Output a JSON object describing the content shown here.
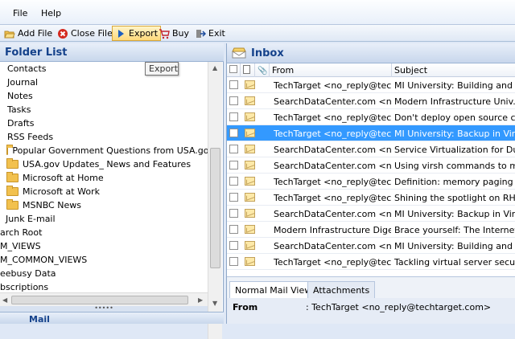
{
  "menu": {
    "file": "File",
    "help": "Help"
  },
  "toolbar": {
    "add_file": "Add File",
    "close_file": "Close File",
    "export": "Export",
    "buy": "Buy",
    "exit": "Exit"
  },
  "tooltip": "Export",
  "folder_list": {
    "title": "Folder List",
    "items": [
      {
        "label": "Contacts",
        "folder": false
      },
      {
        "label": "Journal",
        "folder": false
      },
      {
        "label": "Notes",
        "folder": false
      },
      {
        "label": "Tasks",
        "folder": false
      },
      {
        "label": "Drafts",
        "folder": false
      },
      {
        "label": "RSS Feeds",
        "folder": false
      },
      {
        "label": "Popular Government Questions from USA.gov",
        "folder": true
      },
      {
        "label": "USA.gov Updates_ News and Features",
        "folder": true
      },
      {
        "label": "Microsoft at Home",
        "folder": true
      },
      {
        "label": "Microsoft at Work",
        "folder": true
      },
      {
        "label": "MSNBC News",
        "folder": true
      },
      {
        "label": "Junk E-mail",
        "folder": false
      },
      {
        "label": "arch Root",
        "folder": false
      },
      {
        "label": "M_VIEWS",
        "folder": false
      },
      {
        "label": "M_COMMON_VIEWS",
        "folder": false
      },
      {
        "label": "eebusy Data",
        "folder": false
      },
      {
        "label": "bscriptions",
        "folder": false
      }
    ],
    "mail_label": "Mail"
  },
  "inbox": {
    "title": "Inbox",
    "columns": {
      "from": "From",
      "subject": "Subject"
    },
    "rows": [
      {
        "from": "TechTarget <no_reply@tech...",
        "subject": "MI University: Building and ..."
      },
      {
        "from": "SearchDataCenter.com <no_...",
        "subject": "Modern Infrastructure Univ..."
      },
      {
        "from": "TechTarget <no_reply@tech...",
        "subject": "Don't deploy open source cl..."
      },
      {
        "from": "TechTarget <no_reply@tech...",
        "subject": "MI University: Backup in Virt..."
      },
      {
        "from": "SearchDataCenter.com <no_...",
        "subject": "Service Virtualization for Du..."
      },
      {
        "from": "SearchDataCenter.com <no_...",
        "subject": "Using virsh commands to m..."
      },
      {
        "from": "TechTarget <no_reply@tech...",
        "subject": "Definition: memory paging"
      },
      {
        "from": "TechTarget <no_reply@tech...",
        "subject": "Shining the spotlight on RH..."
      },
      {
        "from": "SearchDataCenter.com <no_...",
        "subject": "MI University: Backup in Virt..."
      },
      {
        "from": "Modern Infrastructure Diges...",
        "subject": "Brace yourself: The Internet ..."
      },
      {
        "from": "SearchDataCenter.com <no_...",
        "subject": "MI University: Building and ..."
      },
      {
        "from": "TechTarget <no_reply@tech...",
        "subject": "Tackling virtual server securi..."
      }
    ]
  },
  "preview": {
    "tab_normal": "Normal Mail View",
    "tab_attachments": "Attachments",
    "from_label": "From",
    "from_value": ":  TechTarget <no_reply@techtarget.com>"
  }
}
